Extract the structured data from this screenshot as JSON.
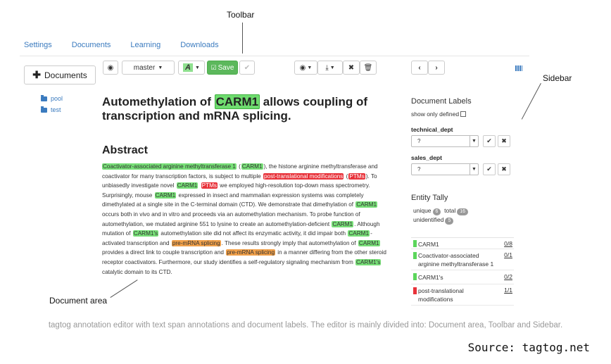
{
  "callouts": {
    "toolbar": "Toolbar",
    "sidebar": "Sidebar",
    "document_area": "Document area"
  },
  "nav": {
    "settings": "Settings",
    "documents": "Documents",
    "learning": "Learning",
    "downloads": "Downloads"
  },
  "left": {
    "documents_button": "Documents",
    "folders": [
      "pool",
      "test"
    ]
  },
  "toolbar": {
    "branch": "master",
    "save_label": "Save",
    "font_label": "A"
  },
  "document": {
    "title_before": "Automethylation of ",
    "title_entity": "CARM1",
    "title_after": " allows coupling of transcription and mRNA splicing.",
    "abstract_heading": "Abstract",
    "abstract": [
      {
        "t": "Coactivator-associated arginine methyltransferase 1",
        "c": "g"
      },
      {
        "t": " (",
        "c": ""
      },
      {
        "t": "CARM1",
        "c": "g"
      },
      {
        "t": "), the histone arginine methyltransferase and coactivator for many transcription factors, is subject to multiple ",
        "c": ""
      },
      {
        "t": "post-translational modifications",
        "c": "r"
      },
      {
        "t": " (",
        "c": ""
      },
      {
        "t": "PTMs",
        "c": "r"
      },
      {
        "t": "). To unbiasedly investigate novel ",
        "c": ""
      },
      {
        "t": "CARM1",
        "c": "g"
      },
      {
        "t": " ",
        "c": ""
      },
      {
        "t": "PTMs",
        "c": "r"
      },
      {
        "t": " we employed high-resolution top-down mass spectrometry. Surprisingly, mouse ",
        "c": ""
      },
      {
        "t": "CARM1",
        "c": "g"
      },
      {
        "t": " expressed in insect and mammalian expression systems was completely dimethylated at a single site in the C-terminal domain (CTD). We demonstrate that dimethylation of ",
        "c": ""
      },
      {
        "t": "CARM1",
        "c": "g"
      },
      {
        "t": " occurs both in vivo and in vitro and proceeds via an automethylation mechanism. To probe function of automethylation, we mutated arginine 551 to lysine to create an automethylation-deficient ",
        "c": ""
      },
      {
        "t": "CARM1",
        "c": "g"
      },
      {
        "t": ". Although mutation of ",
        "c": ""
      },
      {
        "t": "CARM1's",
        "c": "g"
      },
      {
        "t": " automethylation site did not affect its enzymatic activity, it did impair both ",
        "c": ""
      },
      {
        "t": "CARM1",
        "c": "g"
      },
      {
        "t": "-activated transcription and ",
        "c": ""
      },
      {
        "t": "pre-mRNA splicing",
        "c": "o"
      },
      {
        "t": ". These results strongly imply that automethylation of ",
        "c": ""
      },
      {
        "t": "CARM1",
        "c": "g"
      },
      {
        "t": " provides a direct link to couple transcription and ",
        "c": ""
      },
      {
        "t": "pre-mRNA splicing",
        "c": "o"
      },
      {
        "t": " in a manner differing from the other steroid receptor coactivators. Furthermore, our study identifies a self-regulatory signaling mechanism from ",
        "c": ""
      },
      {
        "t": "CARM1's",
        "c": "g"
      },
      {
        "t": " catalytic domain to its CTD.",
        "c": ""
      }
    ]
  },
  "sidebar": {
    "doc_labels_title": "Document Labels",
    "show_only_defined": "show only defined",
    "labels": [
      {
        "name": "technical_dept",
        "value": "?"
      },
      {
        "name": "sales_dept",
        "value": "?"
      }
    ],
    "entity_tally_title": "Entity Tally",
    "unique_label": "unique",
    "unique_count": "6",
    "total_label": "total",
    "total_count": "16",
    "unidentified_label": "unidentified",
    "unidentified_count": "5",
    "tally": [
      {
        "name": "CARM1",
        "count": "0/8",
        "color": "#5cd65c"
      },
      {
        "name": "Coactivator-associated arginine methyltransferase 1",
        "count": "0/1",
        "color": "#5cd65c"
      },
      {
        "name": "CARM1's",
        "count": "0/2",
        "color": "#5cd65c"
      },
      {
        "name": "post-translational modifications",
        "count": "1/1",
        "color": "#e8323a"
      }
    ]
  },
  "caption": "tagtog annotation editor with text span annotations and document labels. The editor is mainly divided into: Document area, Toolbar and Sidebar.",
  "source": "Source: tagtog.net"
}
